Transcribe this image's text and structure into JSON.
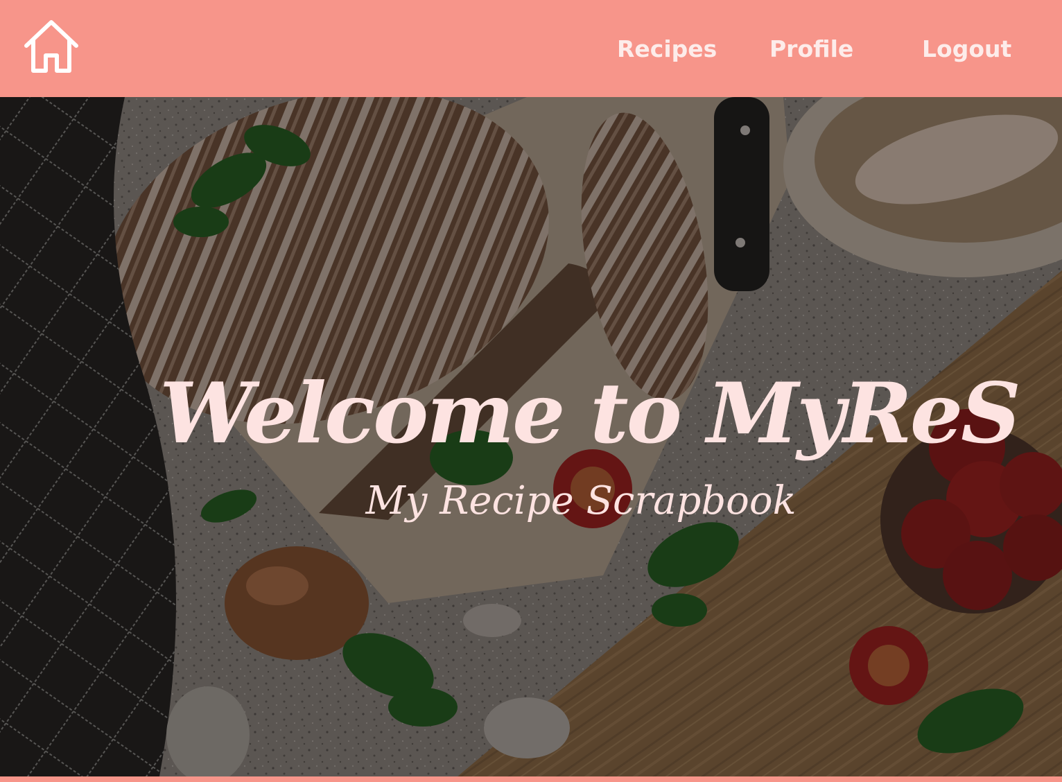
{
  "header": {
    "home_icon": "home-icon",
    "nav": {
      "recipes": "Recipes",
      "profile": "Profile",
      "logout": "Logout"
    }
  },
  "hero": {
    "title": "Welcome to MyReS",
    "subtitle": "My Recipe Scrapbook",
    "background_image": "kitchen-table-bread-tomatoes-photo"
  },
  "colors": {
    "brand": "#f7958a",
    "text_light": "#fde3e1"
  }
}
